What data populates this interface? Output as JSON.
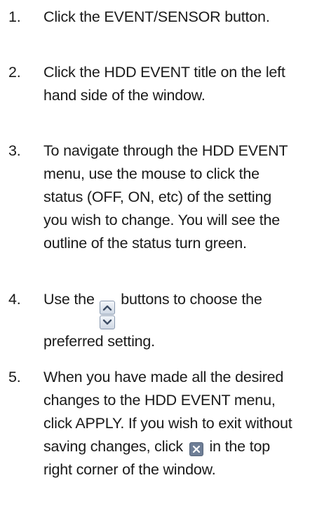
{
  "steps": [
    {
      "number": "1.",
      "lines": [
        "Click the EVENT/SENSOR button."
      ]
    },
    {
      "number": "2.",
      "lines": [
        "Click the HDD EVENT title on the left",
        "hand side of the window."
      ]
    },
    {
      "number": "3.",
      "lines": [
        "To navigate through the HDD EVENT",
        "menu, use the mouse to click the",
        "status (OFF, ON, etc) of the setting",
        "you wish to change.  You will see the",
        "outline of the status turn green."
      ]
    },
    {
      "number": "4.",
      "line1_before": "Use the",
      "line1_after": "buttons to choose the",
      "line2": "preferred setting.",
      "icon": "up-down-arrow-buttons-icon"
    },
    {
      "number": "5.",
      "lines": [
        "When you have made all the desired",
        "changes to the HDD EVENT menu,",
        "click APPLY.  If you wish to exit without"
      ],
      "line4_before": "saving changes, click",
      "line4_after": "in the top",
      "line5": "right corner of the window.",
      "icon": "close-x-icon"
    }
  ]
}
